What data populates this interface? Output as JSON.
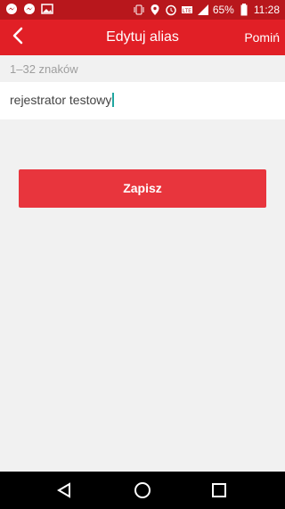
{
  "status_bar": {
    "icons_left": [
      "messenger-icon",
      "messenger-icon",
      "image-icon"
    ],
    "icons_right": [
      "vibrate-icon",
      "location-icon",
      "alarm-icon",
      "lte-icon",
      "signal-icon"
    ],
    "battery": "65%",
    "time": "11:28"
  },
  "header": {
    "title": "Edytuj alias",
    "skip_label": "Pomiń"
  },
  "form": {
    "hint": "1–32 znaków",
    "value": "rejestrator testowy"
  },
  "buttons": {
    "save_label": "Zapisz"
  },
  "colors": {
    "status_bar": "#b8171c",
    "header": "#e11f26",
    "button": "#e8353d"
  },
  "nav": {
    "items": [
      "back-triangle-icon",
      "home-circle-icon",
      "recents-square-icon"
    ]
  }
}
